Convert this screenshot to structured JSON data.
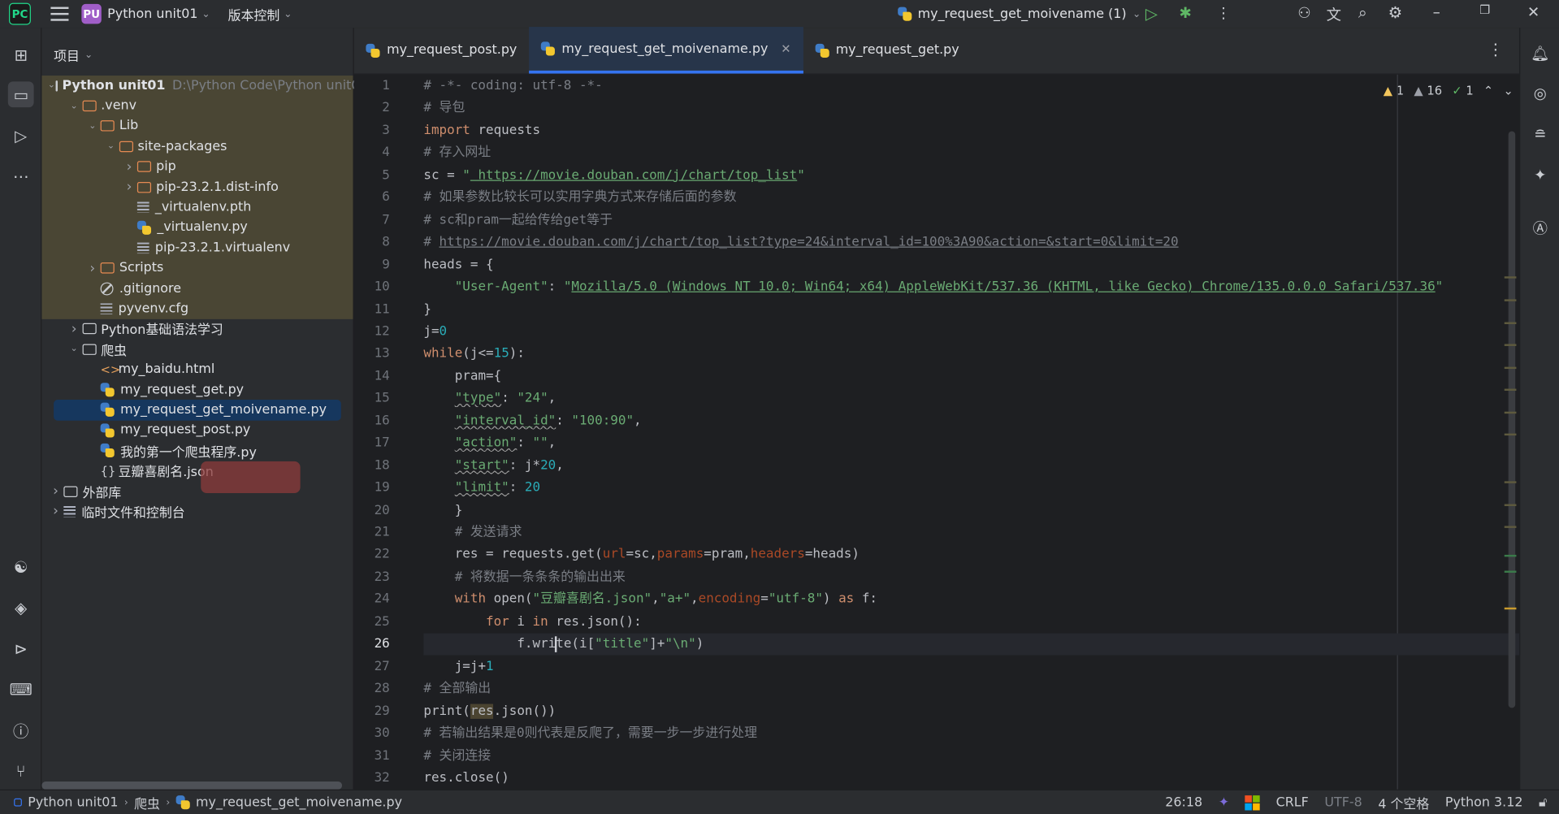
{
  "titlebar": {
    "project_badge": "PU",
    "project_name": "Python unit01",
    "vcs_label": "版本控制",
    "run_config": "my_request_get_moivename (1)"
  },
  "project_panel": {
    "header": "项目",
    "tree": [
      {
        "label": "Python unit01",
        "path": "D:\\Python Code\\Python unit0",
        "indent": 0,
        "kind": "folder",
        "open": true,
        "bold": true
      },
      {
        "label": ".venv",
        "indent": 1,
        "kind": "folder-orange",
        "open": true
      },
      {
        "label": "Lib",
        "indent": 2,
        "kind": "folder-orange",
        "open": true
      },
      {
        "label": "site-packages",
        "indent": 3,
        "kind": "folder-orange",
        "open": true
      },
      {
        "label": "pip",
        "indent": 4,
        "kind": "folder-orange",
        "open": false
      },
      {
        "label": "pip-23.2.1.dist-info",
        "indent": 4,
        "kind": "folder-orange",
        "open": false
      },
      {
        "label": "_virtualenv.pth",
        "indent": 4,
        "kind": "text"
      },
      {
        "label": "_virtualenv.py",
        "indent": 4,
        "kind": "python"
      },
      {
        "label": "pip-23.2.1.virtualenv",
        "indent": 4,
        "kind": "text"
      },
      {
        "label": "Scripts",
        "indent": 2,
        "kind": "folder-orange",
        "open": false
      },
      {
        "label": ".gitignore",
        "indent": 2,
        "kind": "ignore"
      },
      {
        "label": "pyvenv.cfg",
        "indent": 2,
        "kind": "text"
      },
      {
        "label": "Python基础语法学习",
        "indent": 1,
        "kind": "folder",
        "open": false
      },
      {
        "label": "爬虫",
        "indent": 1,
        "kind": "folder",
        "open": true
      },
      {
        "label": "my_baidu.html",
        "indent": 2,
        "kind": "html"
      },
      {
        "label": "my_request_get.py",
        "indent": 2,
        "kind": "python"
      },
      {
        "label": "my_request_get_moivename.py",
        "indent": 2,
        "kind": "python",
        "selected": true
      },
      {
        "label": "my_request_post.py",
        "indent": 2,
        "kind": "python"
      },
      {
        "label": "我的第一个爬虫程序.py",
        "indent": 2,
        "kind": "python"
      },
      {
        "label": "豆瓣喜剧名.json",
        "indent": 2,
        "kind": "json"
      },
      {
        "label": "外部库",
        "indent": 0,
        "kind": "library",
        "open": false
      },
      {
        "label": "临时文件和控制台",
        "indent": 0,
        "kind": "scratch",
        "open": false
      }
    ]
  },
  "tabs": [
    {
      "label": "my_request_post.py",
      "active": false
    },
    {
      "label": "my_request_get_moivename.py",
      "active": true
    },
    {
      "label": "my_request_get.py",
      "active": false
    }
  ],
  "inspections": {
    "warnings_a": "1",
    "warnings_b": "16",
    "ok": "1"
  },
  "code_lines": [
    "# -*- coding: utf-8 -*-",
    "# 导包",
    "import requests",
    "# 存入网址",
    "sc = \" https://movie.douban.com/j/chart/top_list\"",
    "# 如果参数比较长可以实用字典方式来存储后面的参数",
    "# sc和pram一起给传给get等于",
    "# https://movie.douban.com/j/chart/top_list?type=24&interval_id=100%3A90&action=&start=0&limit=20",
    "heads = {",
    "    \"User-Agent\": \"Mozilla/5.0 (Windows NT 10.0; Win64; x64) AppleWebKit/537.36 (KHTML, like Gecko) Chrome/135.0.0.0 Safari/537.36\"",
    "}",
    "j=0",
    "while(j<=15):",
    "    pram={",
    "    \"type\": \"24\",",
    "    \"interval_id\": \"100:90\",",
    "    \"action\": \"\",",
    "    \"start\": j*20,",
    "    \"limit\": 20",
    "    }",
    "    # 发送请求",
    "    res = requests.get(url=sc,params=pram,headers=heads)",
    "    # 将数据一条条条的输出出来",
    "    with open(\"豆瓣喜剧名.json\",\"a+\",encoding=\"utf-8\") as f:",
    "        for i in res.json():",
    "            f.write(i[\"title\"]+\"\\n\")",
    "    j=j+1",
    "# 全部输出",
    "print(res.json())",
    "# 若输出结果是0则代表是反爬了，需要一步一步进行处理",
    "# 关闭连接",
    "res.close()"
  ],
  "line_numbers": [
    "1",
    "2",
    "3",
    "4",
    "5",
    "6",
    "7",
    "8",
    "9",
    "10",
    "11",
    "12",
    "13",
    "14",
    "15",
    "16",
    "17",
    "18",
    "19",
    "20",
    "21",
    "22",
    "23",
    "24",
    "25",
    "26",
    "27",
    "28",
    "29",
    "30",
    "31",
    "32"
  ],
  "current_line": 26,
  "statusbar": {
    "crumb_project": "Python unit01",
    "crumb_folder": "爬虫",
    "crumb_file": "my_request_get_moivename.py",
    "position": "26:18",
    "line_sep": "CRLF",
    "encoding": "UTF-8",
    "indent": "4 个空格",
    "interpreter": "Python 3.12"
  },
  "colors": {
    "accent": "#3574f0",
    "selection": "#16375e",
    "highlight": "#4a4634"
  }
}
